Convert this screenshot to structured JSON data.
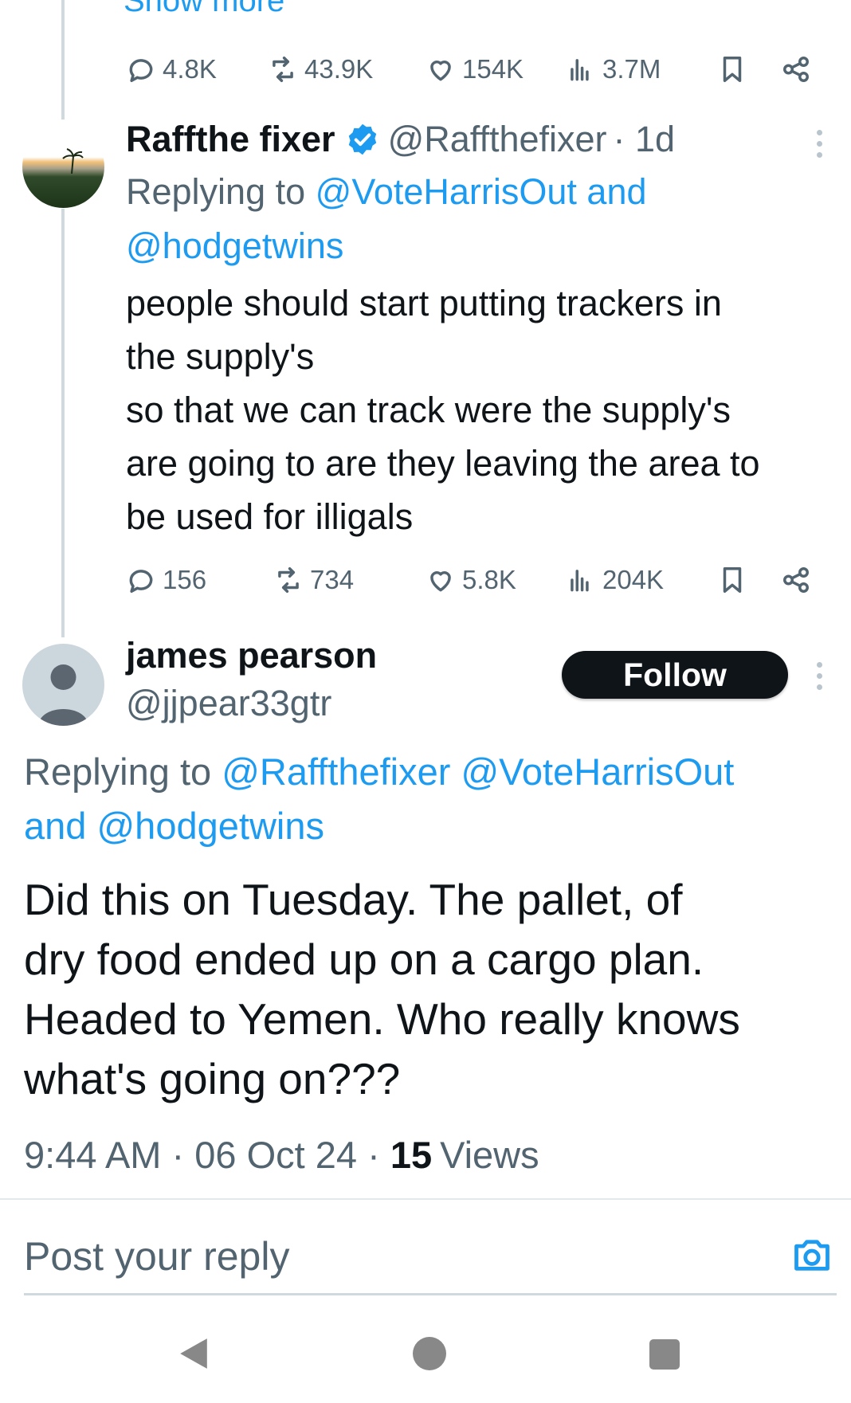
{
  "top": {
    "show_more": "Show more",
    "stats": {
      "replies": "4.8K",
      "reposts": "43.9K",
      "likes": "154K",
      "views": "3.7M"
    }
  },
  "reply1": {
    "display_name": "Raffthe fixer",
    "handle": "@Raffthefixer",
    "age": "· 1d",
    "replying_prefix": "Replying to ",
    "replying_line1": "@VoteHarrisOut and",
    "replying_line2": "@hodgetwins",
    "text": "people should start putting trackers in\nthe supply's\nso that we can track were the supply's\nare going to are they leaving the area to\nbe used for illigals",
    "stats": {
      "replies": "156",
      "reposts": "734",
      "likes": "5.8K",
      "views": "204K"
    }
  },
  "main": {
    "display_name": "james pearson",
    "handle": "@jjpear33gtr",
    "follow_label": "Follow",
    "replying_prefix": "Replying to ",
    "replying_line1": "@Raffthefixer @VoteHarrisOut",
    "replying_line2": "and @hodgetwins",
    "text": "Did this on Tuesday. The pallet, of\ndry food ended up on a cargo plan.\nHeaded to Yemen. Who really knows\nwhat's going on???",
    "time": "9:44 AM",
    "date": "06 Oct 24",
    "views_count": "15",
    "views_label": "Views"
  },
  "composer": {
    "placeholder": "Post your reply"
  },
  "icons": {
    "reply": "reply-icon",
    "repost": "repost-icon",
    "like": "like-icon",
    "views": "views-icon",
    "bookmark": "bookmark-icon",
    "share": "share-icon",
    "camera": "camera-icon",
    "verified": "verified-badge-icon",
    "more": "more-options-icon",
    "nav_back": "back-triangle-icon",
    "nav_home": "home-circle-icon",
    "nav_recents": "recents-square-icon"
  },
  "colors": {
    "accent": "#1d9bf0",
    "text": "#0f1419",
    "secondary": "#536471",
    "divider": "#cfd9de"
  }
}
